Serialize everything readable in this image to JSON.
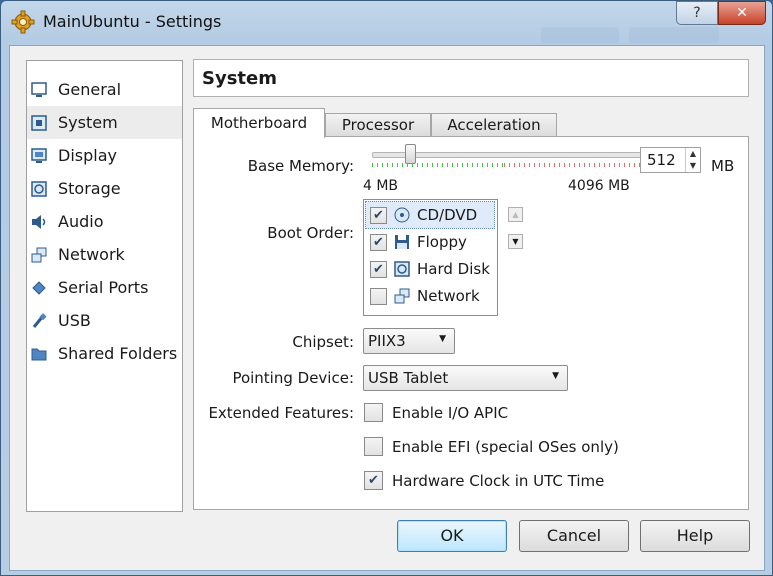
{
  "window": {
    "title": "MainUbuntu - Settings",
    "help_glyph": "?",
    "close_glyph": "✕"
  },
  "sidebar": {
    "items": [
      {
        "label": "General",
        "icon": "monitor-icon"
      },
      {
        "label": "System",
        "icon": "chip-icon",
        "selected": true
      },
      {
        "label": "Display",
        "icon": "display-icon"
      },
      {
        "label": "Storage",
        "icon": "disc-icon"
      },
      {
        "label": "Audio",
        "icon": "speaker-icon"
      },
      {
        "label": "Network",
        "icon": "network-icon"
      },
      {
        "label": "Serial Ports",
        "icon": "serial-port-icon"
      },
      {
        "label": "USB",
        "icon": "usb-icon"
      },
      {
        "label": "Shared Folders",
        "icon": "folder-icon"
      }
    ]
  },
  "header": {
    "title": "System"
  },
  "tabs": {
    "motherboard": "Motherboard",
    "processor": "Processor",
    "acceleration": "Acceleration"
  },
  "motherboard": {
    "base_memory_label": "Base Memory:",
    "memory_min": "4 MB",
    "memory_max": "4096 MB",
    "memory_value": "512",
    "memory_unit": "MB",
    "memory_fraction": 0.125,
    "boot_order_label": "Boot Order:",
    "boot_items": [
      {
        "label": "CD/DVD",
        "checked": true,
        "icon": "cd-icon"
      },
      {
        "label": "Floppy",
        "checked": true,
        "icon": "floppy-icon"
      },
      {
        "label": "Hard Disk",
        "checked": true,
        "icon": "hard-disk-icon"
      },
      {
        "label": "Network",
        "checked": false,
        "icon": "network-icon"
      }
    ],
    "chipset_label": "Chipset:",
    "chipset_value": "PIIX3",
    "pointing_label": "Pointing Device:",
    "pointing_value": "USB Tablet",
    "extended_label": "Extended Features:",
    "features": [
      {
        "label": "Enable I/O APIC",
        "checked": false
      },
      {
        "label": "Enable EFI (special OSes only)",
        "checked": false
      },
      {
        "label": "Hardware Clock in UTC Time",
        "checked": true
      }
    ]
  },
  "buttons": {
    "ok": "OK",
    "cancel": "Cancel",
    "help": "Help"
  },
  "colors": {
    "accent": "#3c7fb1",
    "check": "#2a4a6a",
    "slider_ok": "#46c046",
    "slider_warn": "#e07070"
  }
}
